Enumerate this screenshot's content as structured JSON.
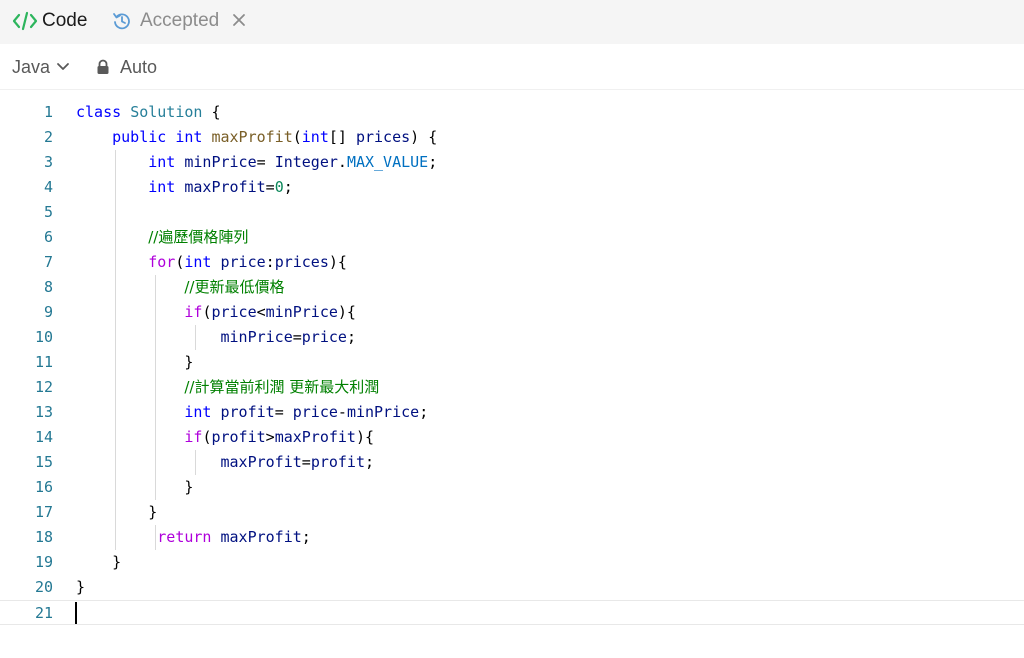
{
  "tabs": {
    "code_label": "Code",
    "accepted_label": "Accepted"
  },
  "toolbar": {
    "language": "Java",
    "mode": "Auto"
  },
  "editor": {
    "lines": [
      {
        "n": "1",
        "tokens": [
          [
            "kw",
            "class"
          ],
          [
            "pl",
            " "
          ],
          [
            "typ",
            "Solution"
          ],
          [
            "pl",
            " {"
          ]
        ]
      },
      {
        "n": "2",
        "tokens": [
          [
            "pl",
            "    "
          ],
          [
            "kw",
            "public"
          ],
          [
            "pl",
            " "
          ],
          [
            "kw",
            "int"
          ],
          [
            "pl",
            " "
          ],
          [
            "fn",
            "maxProfit"
          ],
          [
            "pl",
            "("
          ],
          [
            "kw",
            "int"
          ],
          [
            "pl",
            "[] "
          ],
          [
            "var",
            "prices"
          ],
          [
            "pl",
            ") {"
          ]
        ]
      },
      {
        "n": "3",
        "tokens": [
          [
            "pl",
            "        "
          ],
          [
            "kw",
            "int"
          ],
          [
            "pl",
            " "
          ],
          [
            "var",
            "minPrice"
          ],
          [
            "pl",
            "= "
          ],
          [
            "var",
            "Integer"
          ],
          [
            "pl",
            "."
          ],
          [
            "cst",
            "MAX_VALUE"
          ],
          [
            "pl",
            ";"
          ]
        ]
      },
      {
        "n": "4",
        "tokens": [
          [
            "pl",
            "        "
          ],
          [
            "kw",
            "int"
          ],
          [
            "pl",
            " "
          ],
          [
            "var",
            "maxProfit"
          ],
          [
            "pl",
            "="
          ],
          [
            "num",
            "0"
          ],
          [
            "pl",
            ";"
          ]
        ]
      },
      {
        "n": "5",
        "tokens": []
      },
      {
        "n": "6",
        "tokens": [
          [
            "pl",
            "        "
          ],
          [
            "cmt",
            "//遍歷價格陣列"
          ]
        ]
      },
      {
        "n": "7",
        "tokens": [
          [
            "pl",
            "        "
          ],
          [
            "ctl",
            "for"
          ],
          [
            "pl",
            "("
          ],
          [
            "kw",
            "int"
          ],
          [
            "pl",
            " "
          ],
          [
            "var",
            "price"
          ],
          [
            "pl",
            ":"
          ],
          [
            "var",
            "prices"
          ],
          [
            "pl",
            "){"
          ]
        ]
      },
      {
        "n": "8",
        "tokens": [
          [
            "pl",
            "            "
          ],
          [
            "cmt",
            "//更新最低價格"
          ]
        ]
      },
      {
        "n": "9",
        "tokens": [
          [
            "pl",
            "            "
          ],
          [
            "ctl",
            "if"
          ],
          [
            "pl",
            "("
          ],
          [
            "var",
            "price"
          ],
          [
            "pl",
            "<"
          ],
          [
            "var",
            "minPrice"
          ],
          [
            "pl",
            "){"
          ]
        ]
      },
      {
        "n": "10",
        "tokens": [
          [
            "pl",
            "                "
          ],
          [
            "var",
            "minPrice"
          ],
          [
            "pl",
            "="
          ],
          [
            "var",
            "price"
          ],
          [
            "pl",
            ";"
          ]
        ]
      },
      {
        "n": "11",
        "tokens": [
          [
            "pl",
            "            }"
          ]
        ]
      },
      {
        "n": "12",
        "tokens": [
          [
            "pl",
            "            "
          ],
          [
            "cmt",
            "//計算當前利潤 更新最大利潤"
          ]
        ]
      },
      {
        "n": "13",
        "tokens": [
          [
            "pl",
            "            "
          ],
          [
            "kw",
            "int"
          ],
          [
            "pl",
            " "
          ],
          [
            "var",
            "profit"
          ],
          [
            "pl",
            "= "
          ],
          [
            "var",
            "price"
          ],
          [
            "pl",
            "-"
          ],
          [
            "var",
            "minPrice"
          ],
          [
            "pl",
            ";"
          ]
        ]
      },
      {
        "n": "14",
        "tokens": [
          [
            "pl",
            "            "
          ],
          [
            "ctl",
            "if"
          ],
          [
            "pl",
            "("
          ],
          [
            "var",
            "profit"
          ],
          [
            "pl",
            ">"
          ],
          [
            "var",
            "maxProfit"
          ],
          [
            "pl",
            "){"
          ]
        ]
      },
      {
        "n": "15",
        "tokens": [
          [
            "pl",
            "                "
          ],
          [
            "var",
            "maxProfit"
          ],
          [
            "pl",
            "="
          ],
          [
            "var",
            "profit"
          ],
          [
            "pl",
            ";"
          ]
        ]
      },
      {
        "n": "16",
        "tokens": [
          [
            "pl",
            "            }"
          ]
        ]
      },
      {
        "n": "17",
        "tokens": [
          [
            "pl",
            "        }"
          ]
        ]
      },
      {
        "n": "18",
        "tokens": [
          [
            "pl",
            "         "
          ],
          [
            "ctl",
            "return"
          ],
          [
            "pl",
            " "
          ],
          [
            "var",
            "maxProfit"
          ],
          [
            "pl",
            ";"
          ]
        ]
      },
      {
        "n": "19",
        "tokens": [
          [
            "pl",
            "    }"
          ]
        ]
      },
      {
        "n": "20",
        "tokens": [
          [
            "pl",
            "}"
          ]
        ]
      },
      {
        "n": "21",
        "tokens": []
      }
    ],
    "current_line": "21"
  },
  "colors": {
    "code_icon": "#2db55d",
    "history_icon": "#5b9bd5",
    "line_number": "#237893"
  }
}
